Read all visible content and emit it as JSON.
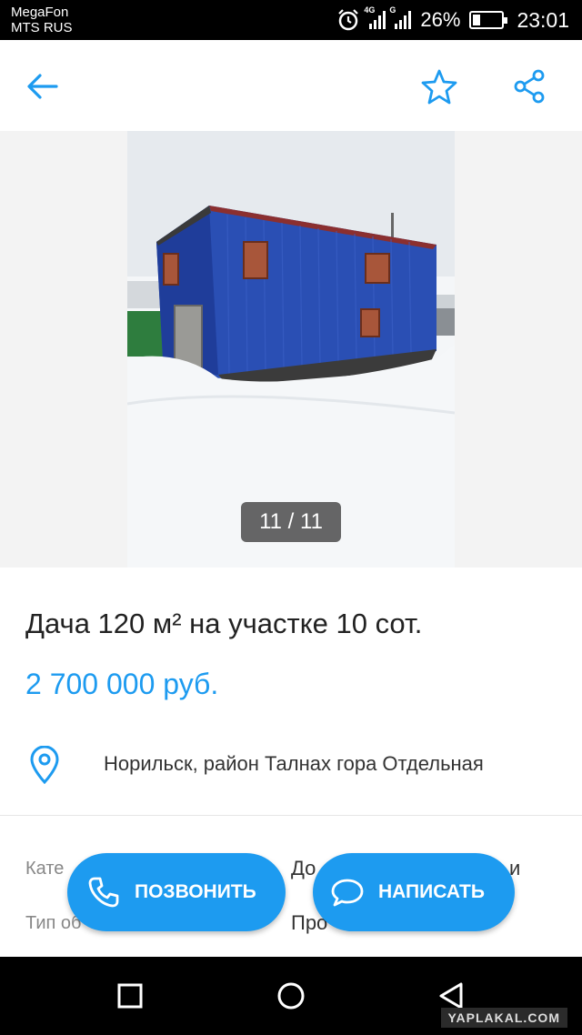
{
  "status": {
    "carrier1": "MegaFon",
    "carrier2": "MTS RUS",
    "net1": "4G",
    "net2": "G",
    "battery_pct": "26%",
    "battery_level": 0.26,
    "time": "23:01"
  },
  "appbar": {
    "back_icon": "arrow-left-icon",
    "favorite_icon": "star-outline-icon",
    "share_icon": "share-icon",
    "accent": "#1d9bf0"
  },
  "gallery": {
    "counter": "11 / 11"
  },
  "listing": {
    "title": "Дача 120 м² на участке 10 сот.",
    "price": "2 700 000 руб.",
    "address": "Норильск, район Талнах гора Отдельная"
  },
  "params": [
    {
      "label": "Кате",
      "value": "До",
      "value_tail": "и"
    },
    {
      "label": "Тип об",
      "value": "Про"
    }
  ],
  "actions": {
    "call_label": "ПОЗВОНИТЬ",
    "write_label": "НАПИСАТЬ"
  },
  "watermark": "YAPLAKAL.COM"
}
